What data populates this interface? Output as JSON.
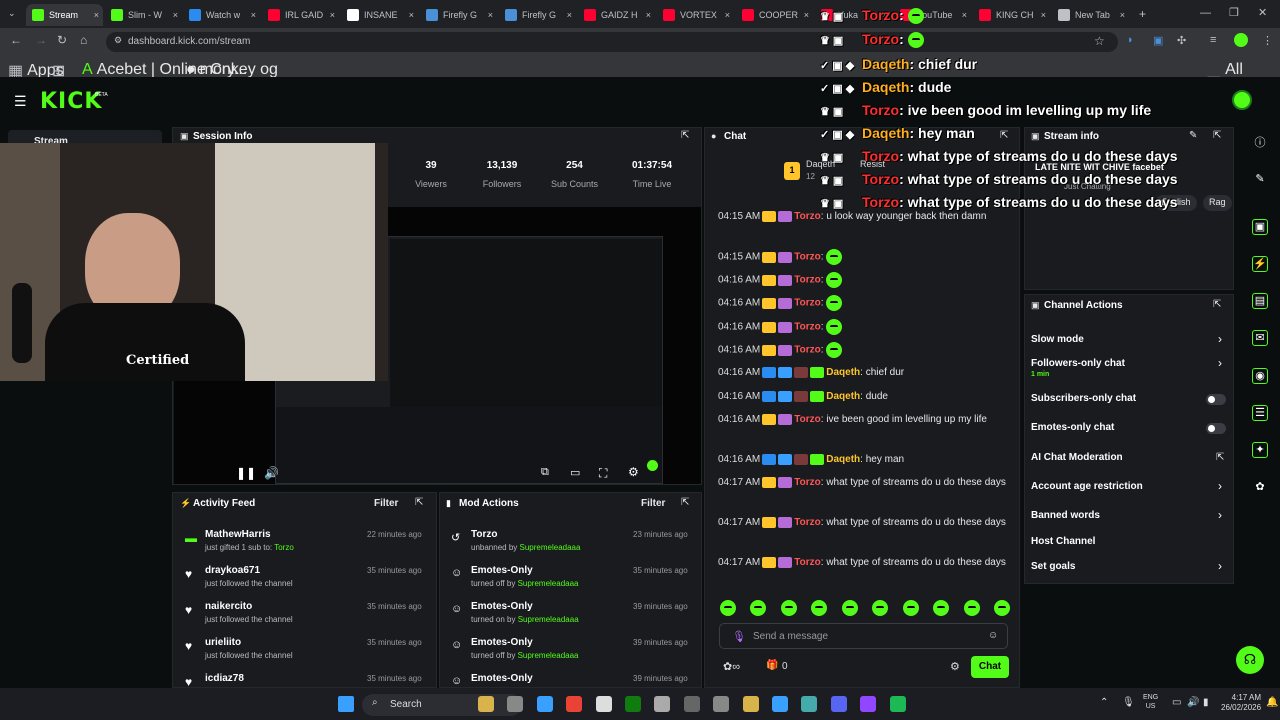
{
  "browser": {
    "tabs": [
      {
        "label": "Stream",
        "active": true,
        "color": "#53fc18"
      },
      {
        "label": "Slim - W",
        "color": "#53fc18"
      },
      {
        "label": "Watch w",
        "color": "#2a8cf0"
      },
      {
        "label": "IRL GAID",
        "color": "#ff0033"
      },
      {
        "label": "INSANE",
        "color": "#ffffff"
      },
      {
        "label": "Firefly G",
        "color": "#4a90d9"
      },
      {
        "label": "Firefly G",
        "color": "#4a90d9"
      },
      {
        "label": "GAIDZ H",
        "color": "#ff0033"
      },
      {
        "label": "VORTEX",
        "color": "#ff0033"
      },
      {
        "label": "COOPER",
        "color": "#ff0033"
      },
      {
        "label": "Yuka",
        "color": "#ff0033"
      },
      {
        "label": "YouTube",
        "color": "#ff0033"
      },
      {
        "label": "KING CH",
        "color": "#ff0033"
      },
      {
        "label": "New Tab",
        "color": "#bdc1c6"
      }
    ],
    "url": "dashboard.kick.com/stream",
    "bookmarks": [
      "Apps",
      "Acebet | Online Cry...",
      "monkey og"
    ],
    "all_bookmarks": "All Bookmarks"
  },
  "kick": {
    "logo": "KICK",
    "logo_sup": "BETA",
    "sidebar_label": "Stream"
  },
  "session": {
    "title": "Session Info",
    "stats": [
      {
        "value": "39",
        "label": "Viewers"
      },
      {
        "value": "13,139",
        "label": "Followers"
      },
      {
        "value": "254",
        "label": "Sub Counts"
      },
      {
        "value": "01:37:54",
        "label": "Time Live"
      }
    ]
  },
  "webcam": {
    "shirt": "Certified"
  },
  "activity": {
    "title": "Activity Feed",
    "filter": "Filter",
    "items": [
      {
        "name": "MathewHarris",
        "sub_pre": "just gifted ",
        "sub_mid": "1 sub to: ",
        "sub_user": "Torzo",
        "time": "22 minutes ago"
      },
      {
        "name": "draykoa671",
        "sub": "just followed the channel",
        "time": "35 minutes ago"
      },
      {
        "name": "naikercito",
        "sub": "just followed the channel",
        "time": "35 minutes ago"
      },
      {
        "name": "urieliito",
        "sub": "just followed the channel",
        "time": "35 minutes ago"
      },
      {
        "name": "icdiaz78",
        "sub": "",
        "time": "35 minutes ago"
      }
    ]
  },
  "mod": {
    "title": "Mod Actions",
    "filter": "Filter",
    "items": [
      {
        "name": "Torzo",
        "sub": "unbanned by ",
        "by": "Supremeleadaaa",
        "time": "23 minutes ago"
      },
      {
        "name": "Emotes-Only",
        "sub": "turned off by ",
        "by": "Supremeleadaaa",
        "time": "35 minutes ago"
      },
      {
        "name": "Emotes-Only",
        "sub": "turned on by ",
        "by": "Supremeleadaaa",
        "time": "39 minutes ago"
      },
      {
        "name": "Emotes-Only",
        "sub": "turned off by ",
        "by": "Supremeleadaaa",
        "time": "39 minutes ago"
      },
      {
        "name": "Emotes-Only",
        "sub": "",
        "by": "",
        "time": "39 minutes ago"
      }
    ]
  },
  "chat": {
    "title": "Chat",
    "pinned_user": "Daqeth",
    "pinned_badge": "12",
    "resist": "Resist",
    "messages": [
      {
        "time": "04:15 AM",
        "user": "Torzo",
        "color": "r",
        "text": "u look way younger back then damn"
      },
      {
        "time": "04:15 AM",
        "user": "Torzo",
        "color": "r",
        "emote": true
      },
      {
        "time": "04:16 AM",
        "user": "Torzo",
        "color": "r",
        "emote": true
      },
      {
        "time": "04:16 AM",
        "user": "Torzo",
        "color": "r",
        "emote": true
      },
      {
        "time": "04:16 AM",
        "user": "Torzo",
        "color": "r",
        "emote": true
      },
      {
        "time": "04:16 AM",
        "user": "Torzo",
        "color": "r",
        "emote": true
      },
      {
        "time": "04:16 AM",
        "user": "Daqeth",
        "color": "y",
        "text": "chief dur"
      },
      {
        "time": "04:16 AM",
        "user": "Daqeth",
        "color": "y",
        "text": "dude"
      },
      {
        "time": "04:16 AM",
        "user": "Torzo",
        "color": "r",
        "text": "ive been good im levelling up my life"
      },
      {
        "time": "04:16 AM",
        "user": "Daqeth",
        "color": "y",
        "text": "hey man"
      },
      {
        "time": "04:17 AM",
        "user": "Torzo",
        "color": "r",
        "text": "what type of streams do u do these days"
      },
      {
        "time": "04:17 AM",
        "user": "Torzo",
        "color": "r",
        "text": "what type of streams do u do these days"
      },
      {
        "time": "04:17 AM",
        "user": "Torzo",
        "color": "r",
        "text": "what type of streams do u do these days"
      }
    ],
    "placeholder": "Send a message",
    "count": "0",
    "send": "Chat"
  },
  "stream_info": {
    "title": "Stream info",
    "stream_title": "LATE NITE WIT CHIVE facebet",
    "category": "Just Chatting",
    "tags": [
      "English",
      "Rag"
    ]
  },
  "channel_actions": {
    "title": "Channel Actions",
    "items": [
      {
        "label": "Slow mode",
        "type": "chevron"
      },
      {
        "label": "Followers-only chat",
        "sub": "1 min",
        "type": "chevron"
      },
      {
        "label": "Subscribers-only chat",
        "type": "toggle"
      },
      {
        "label": "Emotes-only chat",
        "type": "toggle"
      },
      {
        "label": "AI Chat Moderation",
        "type": "external"
      },
      {
        "label": "Account age restriction",
        "type": "chevron"
      },
      {
        "label": "Banned words",
        "type": "chevron"
      },
      {
        "label": "Host Channel",
        "type": "none"
      },
      {
        "label": "Set goals",
        "type": "chevron"
      }
    ]
  },
  "overlay": [
    {
      "user": "Torzo",
      "color": "r",
      "text": ""
    },
    {
      "user": "Torzo",
      "color": "r",
      "text": ""
    },
    {
      "user": "Daqeth",
      "color": "y",
      "text": "chief dur"
    },
    {
      "user": "Daqeth",
      "color": "y",
      "text": "dude"
    },
    {
      "user": "Torzo",
      "color": "r",
      "text": "ive been good im levelling up my life"
    },
    {
      "user": "Daqeth",
      "color": "y",
      "text": "hey man"
    },
    {
      "user": "Torzo",
      "color": "r",
      "text": "what type of streams do u do these days"
    },
    {
      "user": "Torzo",
      "color": "r",
      "text": "what type of streams do u do these days"
    },
    {
      "user": "Torzo",
      "color": "r",
      "text": "what type of streams do u do these days"
    }
  ],
  "taskbar": {
    "search": "Search",
    "lang1": "ENG",
    "lang2": "US",
    "time": "4:17 AM",
    "date": "26/02/2026"
  }
}
